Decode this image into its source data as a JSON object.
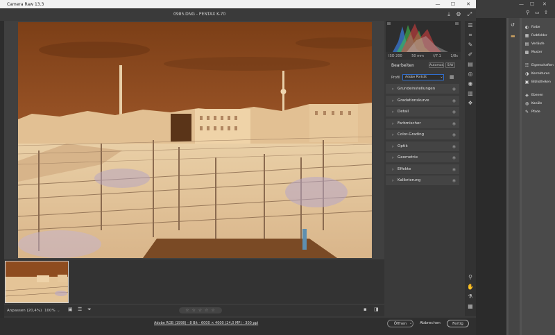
{
  "window": {
    "title": "Camera Raw 13.3",
    "minimize": "—",
    "maximize": "☐",
    "close": "✕"
  },
  "header": {
    "file_title": "0985.DNG - PENTAX K-70",
    "icons": [
      "save-icon",
      "gear-icon",
      "expand-icon"
    ]
  },
  "histogram": {
    "exif": [
      "ISO 200",
      "50 mm",
      "f/7.1",
      "1/8s"
    ]
  },
  "edit_panel": {
    "title": "Bearbeiten",
    "auto_label": "Automat.",
    "bw_label": "S/W",
    "profile_label": "Profil",
    "profile_value": "Adobe Porträt",
    "sections": [
      {
        "label": "Grundeinstellungen"
      },
      {
        "label": "Gradationskurve"
      },
      {
        "label": "Detail"
      },
      {
        "label": "Farbmischer"
      },
      {
        "label": "Color-Grading"
      },
      {
        "label": "Optik"
      },
      {
        "label": "Geometrie"
      },
      {
        "label": "Effekte"
      },
      {
        "label": "Kalibrierung"
      }
    ]
  },
  "status": {
    "fit_label": "Anpassen (20,4%)",
    "zoom_value": "100%",
    "stars": "☆ ☆ ☆ ☆ ☆"
  },
  "footer": {
    "info_link": "Adobe RGB (1998) - 8 Bit - 6000 × 4000 (24,0 MP) - 300 ppi",
    "open_label": "Öffnen",
    "cancel_label": "Abbrechen",
    "done_label": "Fertig"
  },
  "photoshop_panel": {
    "items": [
      {
        "icon": "color-icon",
        "label": "Farbe"
      },
      {
        "icon": "swatches-icon",
        "label": "Farbfelder"
      },
      {
        "icon": "gradient-icon",
        "label": "Verläufe"
      },
      {
        "icon": "patterns-icon",
        "label": "Muster"
      },
      {
        "icon": "properties-icon",
        "label": "Eigenschaften"
      },
      {
        "icon": "adjustments-icon",
        "label": "Korrekturen"
      },
      {
        "icon": "libraries-icon",
        "label": "Bibliotheken"
      },
      {
        "icon": "layers-icon",
        "label": "Ebenen"
      },
      {
        "icon": "channels-icon",
        "label": "Kanäle"
      },
      {
        "icon": "paths-icon",
        "label": "Pfade"
      }
    ]
  },
  "colors": {
    "accent": "#2f6fd0",
    "sky": "#8a4a1c",
    "buildings": "#e8c9a0"
  }
}
